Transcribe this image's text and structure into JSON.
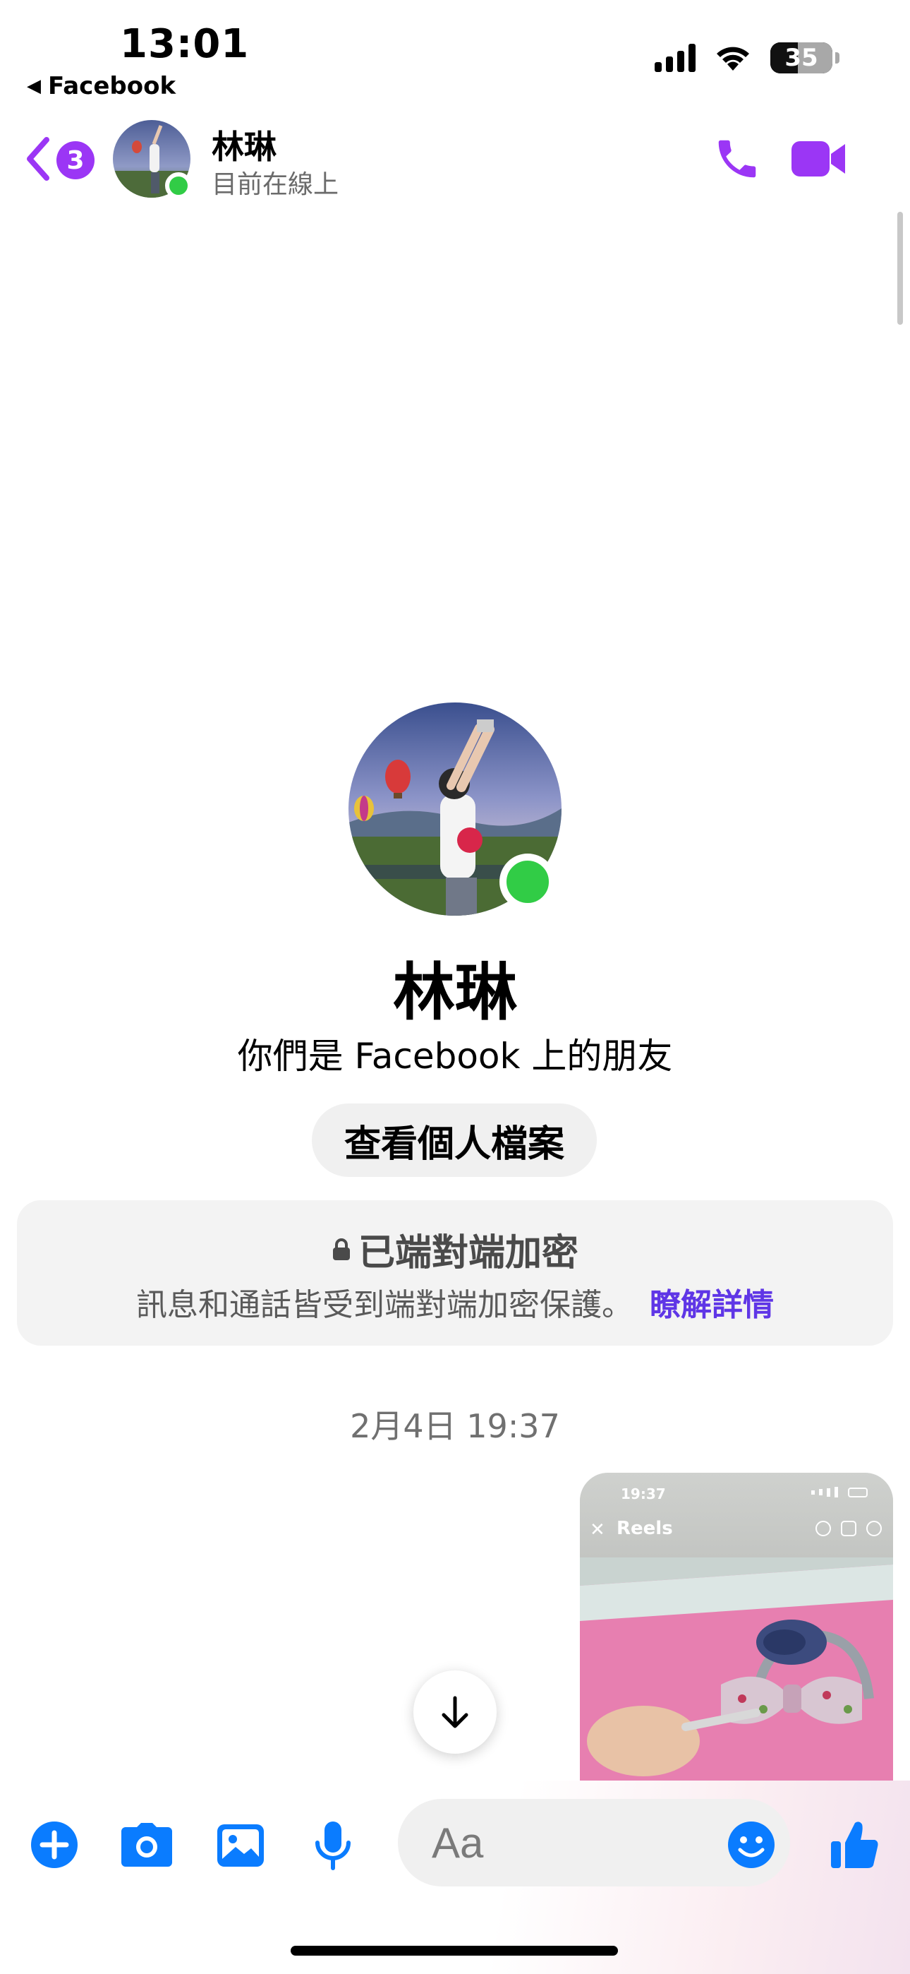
{
  "status_bar": {
    "time": "13:01",
    "back_app": "Facebook",
    "battery": "35",
    "icons": [
      "cellular-signal-icon",
      "wifi-icon",
      "battery-icon"
    ]
  },
  "header": {
    "back_badge": "3",
    "name": "林琳",
    "status": "目前在線上",
    "actions": [
      "phone-icon",
      "video-camera-icon"
    ]
  },
  "profile": {
    "name": "林琳",
    "relation": "你們是 Facebook 上的朋友",
    "view_profile_label": "查看個人檔案"
  },
  "e2ee": {
    "title": "已端對端加密",
    "body": "訊息和通話皆受到端對端加密保護。",
    "link": "瞭解詳情"
  },
  "thread": {
    "timestamp": "2月4日 19:37",
    "shared_reel": {
      "time": "19:37",
      "label": "Reels"
    }
  },
  "composer": {
    "placeholder": "Aa",
    "icons": [
      "plus-icon",
      "camera-icon",
      "gallery-icon",
      "microphone-icon",
      "emoji-icon",
      "thumbs-up-icon"
    ]
  },
  "colors": {
    "accent_purple": "#9b36f5",
    "messenger_blue": "#0a7cff",
    "online_green": "#31cc46",
    "link_purple": "#5f36e6"
  }
}
